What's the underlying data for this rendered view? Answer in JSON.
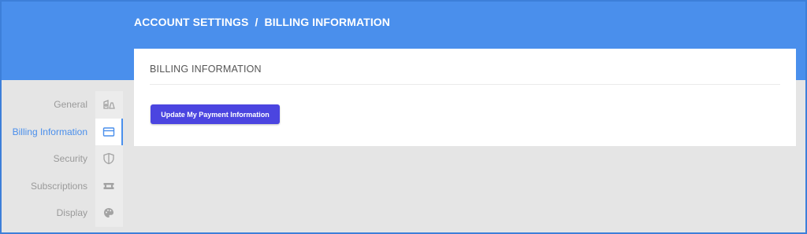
{
  "header": {
    "breadcrumb": {
      "parent": "ACCOUNT SETTINGS",
      "separator": "/",
      "current": "BILLING INFORMATION"
    },
    "color": "#4a8fec"
  },
  "sidebar": {
    "items": [
      {
        "label": "General",
        "icon": "general-icon",
        "active": false
      },
      {
        "label": "Billing Information",
        "icon": "credit-card-icon",
        "active": true
      },
      {
        "label": "Security",
        "icon": "shield-icon",
        "active": false
      },
      {
        "label": "Subscriptions",
        "icon": "ticket-icon",
        "active": false
      },
      {
        "label": "Display",
        "icon": "palette-icon",
        "active": false
      }
    ],
    "active_color": "#4a8fec"
  },
  "main": {
    "card_title": "BILLING INFORMATION",
    "update_payment_label": "Update My Payment Information",
    "button_color": "#4b45e0"
  }
}
